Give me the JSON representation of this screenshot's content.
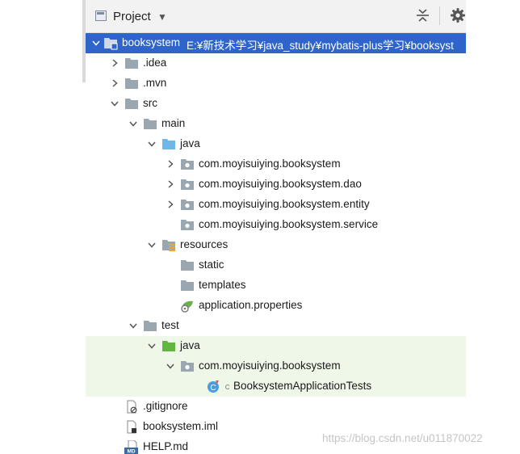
{
  "header": {
    "title": "Project",
    "actions": [
      "collapse-all-icon",
      "gear-icon"
    ]
  },
  "tree": [
    {
      "label": "booksystem",
      "path": "E:¥新技术学习¥java_study¥mybatis-plus学习¥booksyst",
      "icon": "module-folder-icon",
      "chevron": "down",
      "selected": true
    },
    {
      "label": ".idea",
      "icon": "folder-icon",
      "chevron": "right"
    },
    {
      "label": ".mvn",
      "icon": "folder-icon",
      "chevron": "right"
    },
    {
      "label": "src",
      "icon": "folder-icon",
      "chevron": "down"
    },
    {
      "label": "main",
      "icon": "folder-icon",
      "chevron": "down"
    },
    {
      "label": "java",
      "icon": "source-folder-icon",
      "chevron": "down"
    },
    {
      "label": "com.moyisuiying.booksystem",
      "icon": "package-icon",
      "chevron": "right"
    },
    {
      "label": "com.moyisuiying.booksystem.dao",
      "icon": "package-icon",
      "chevron": "right"
    },
    {
      "label": "com.moyisuiying.booksystem.entity",
      "icon": "package-icon",
      "chevron": "right"
    },
    {
      "label": "com.moyisuiying.booksystem.service",
      "icon": "package-icon",
      "chevron": ""
    },
    {
      "label": "resources",
      "icon": "resources-folder-icon",
      "chevron": "down"
    },
    {
      "label": "static",
      "icon": "folder-icon",
      "chevron": ""
    },
    {
      "label": "templates",
      "icon": "folder-icon",
      "chevron": ""
    },
    {
      "label": "application.properties",
      "icon": "spring-properties-icon",
      "chevron": ""
    },
    {
      "label": "test",
      "icon": "folder-icon",
      "chevron": "down"
    },
    {
      "label": "java",
      "icon": "test-source-folder-icon",
      "chevron": "down",
      "highlight": true
    },
    {
      "label": "com.moyisuiying.booksystem",
      "icon": "package-icon",
      "chevron": "down",
      "highlight": true
    },
    {
      "label": "BooksystemApplicationTests",
      "icon": "test-class-icon",
      "chevron": "",
      "highlight": true
    },
    {
      "label": ".gitignore",
      "icon": "ignore-file-icon",
      "chevron": ""
    },
    {
      "label": "booksystem.iml",
      "icon": "iml-file-icon",
      "chevron": ""
    },
    {
      "label": "HELP.md",
      "icon": "markdown-file-icon",
      "chevron": ""
    }
  ],
  "watermark": "https://blog.csdn.net/u011870022",
  "colors": {
    "selection": "#2f65ca",
    "test_highlight": "#eef7e8",
    "folder": "#9aa7b0",
    "source_folder": "#6eb7e6",
    "test_folder": "#62b543"
  }
}
